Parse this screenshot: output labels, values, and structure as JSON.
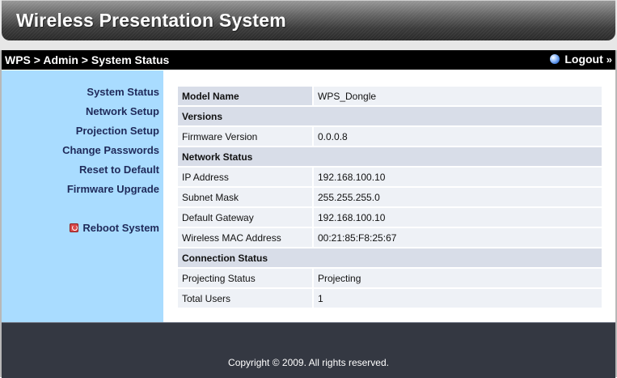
{
  "header": {
    "title": "Wireless Presentation System"
  },
  "breadcrumb": {
    "items": [
      "WPS",
      "Admin",
      "System Status"
    ],
    "separator": " > "
  },
  "logout": {
    "label": "Logout",
    "arrow": "»",
    "icon": "globe-icon"
  },
  "sidebar": {
    "items": [
      {
        "label": "System Status"
      },
      {
        "label": "Network Setup"
      },
      {
        "label": "Projection Setup"
      },
      {
        "label": "Change Passwords"
      },
      {
        "label": "Reset to Default"
      },
      {
        "label": "Firmware Upgrade"
      }
    ],
    "reboot": {
      "label": "Reboot System",
      "icon": "power-icon"
    }
  },
  "status_table": {
    "model": {
      "label": "Model Name",
      "value": "WPS_Dongle"
    },
    "versions_heading": "Versions",
    "firmware": {
      "label": "Firmware Version",
      "value": "0.0.0.8"
    },
    "network_heading": "Network Status",
    "ip": {
      "label": "IP Address",
      "value": "192.168.100.10"
    },
    "subnet": {
      "label": "Subnet Mask",
      "value": "255.255.255.0"
    },
    "gateway": {
      "label": "Default Gateway",
      "value": "192.168.100.10"
    },
    "mac": {
      "label": "Wireless MAC Address",
      "value": "00:21:85:F8:25:67"
    },
    "connection_heading": "Connection Status",
    "projecting": {
      "label": "Projecting Status",
      "value": "Projecting"
    },
    "users": {
      "label": "Total Users",
      "value": "1"
    }
  },
  "footer": {
    "copyright": "Copyright © 2009. All rights reserved."
  }
}
